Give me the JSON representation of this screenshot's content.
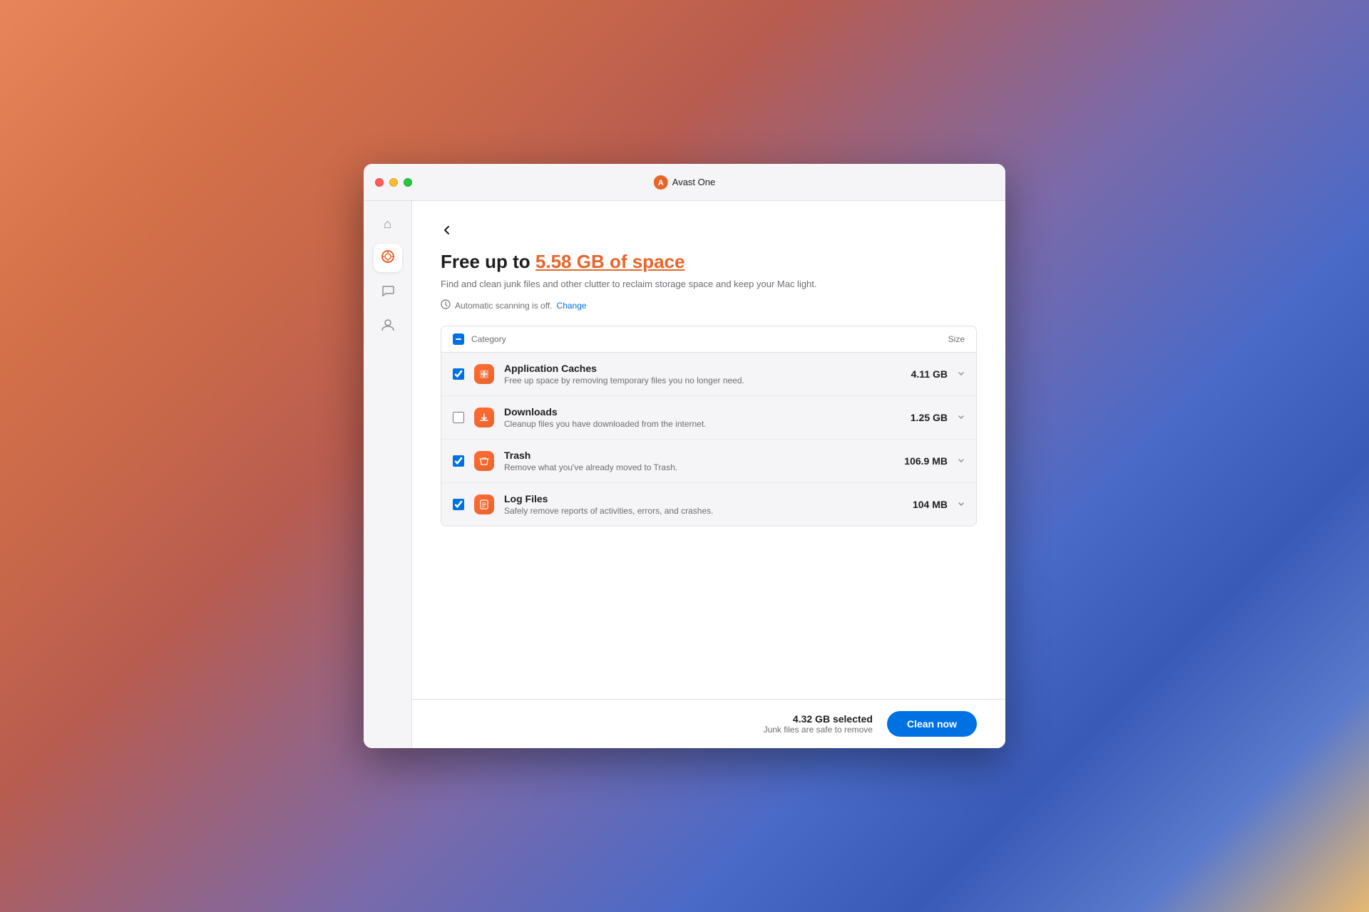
{
  "window": {
    "title": "Avast One"
  },
  "titlebar": {
    "title": "Avast One",
    "back_label": "←"
  },
  "header": {
    "title_prefix": "Free up to ",
    "title_highlight": "5.58 GB of space",
    "subtitle": "Find and clean junk files and other clutter to reclaim storage space and keep your Mac light.",
    "auto_scan_text": "Automatic scanning is off.",
    "change_link": "Change"
  },
  "table": {
    "header": {
      "category_label": "Category",
      "size_label": "Size"
    },
    "rows": [
      {
        "id": "app-caches",
        "name": "Application Caches",
        "description": "Free up space by removing temporary files you no longer need.",
        "size": "4.11 GB",
        "checked": true,
        "icon": "🗃"
      },
      {
        "id": "downloads",
        "name": "Downloads",
        "description": "Cleanup files you have downloaded from the internet.",
        "size": "1.25 GB",
        "checked": false,
        "icon": "⬇"
      },
      {
        "id": "trash",
        "name": "Trash",
        "description": "Remove what you've already moved to Trash.",
        "size": "106.9 MB",
        "checked": true,
        "icon": "🗑"
      },
      {
        "id": "log-files",
        "name": "Log Files",
        "description": "Safely remove reports of activities, errors, and crashes.",
        "size": "104 MB",
        "checked": true,
        "icon": "📋"
      }
    ]
  },
  "footer": {
    "selected_text": "4.32 GB selected",
    "note_text": "Junk files are safe to remove",
    "clean_button_label": "Clean now"
  },
  "sidebar": {
    "items": [
      {
        "id": "home",
        "icon": "⌂",
        "label": "Home",
        "active": false
      },
      {
        "id": "cleanup",
        "icon": "◎",
        "label": "Cleanup",
        "active": true
      },
      {
        "id": "feedback",
        "icon": "💬",
        "label": "Feedback",
        "active": false
      },
      {
        "id": "account",
        "icon": "👤",
        "label": "Account",
        "active": false
      }
    ]
  }
}
